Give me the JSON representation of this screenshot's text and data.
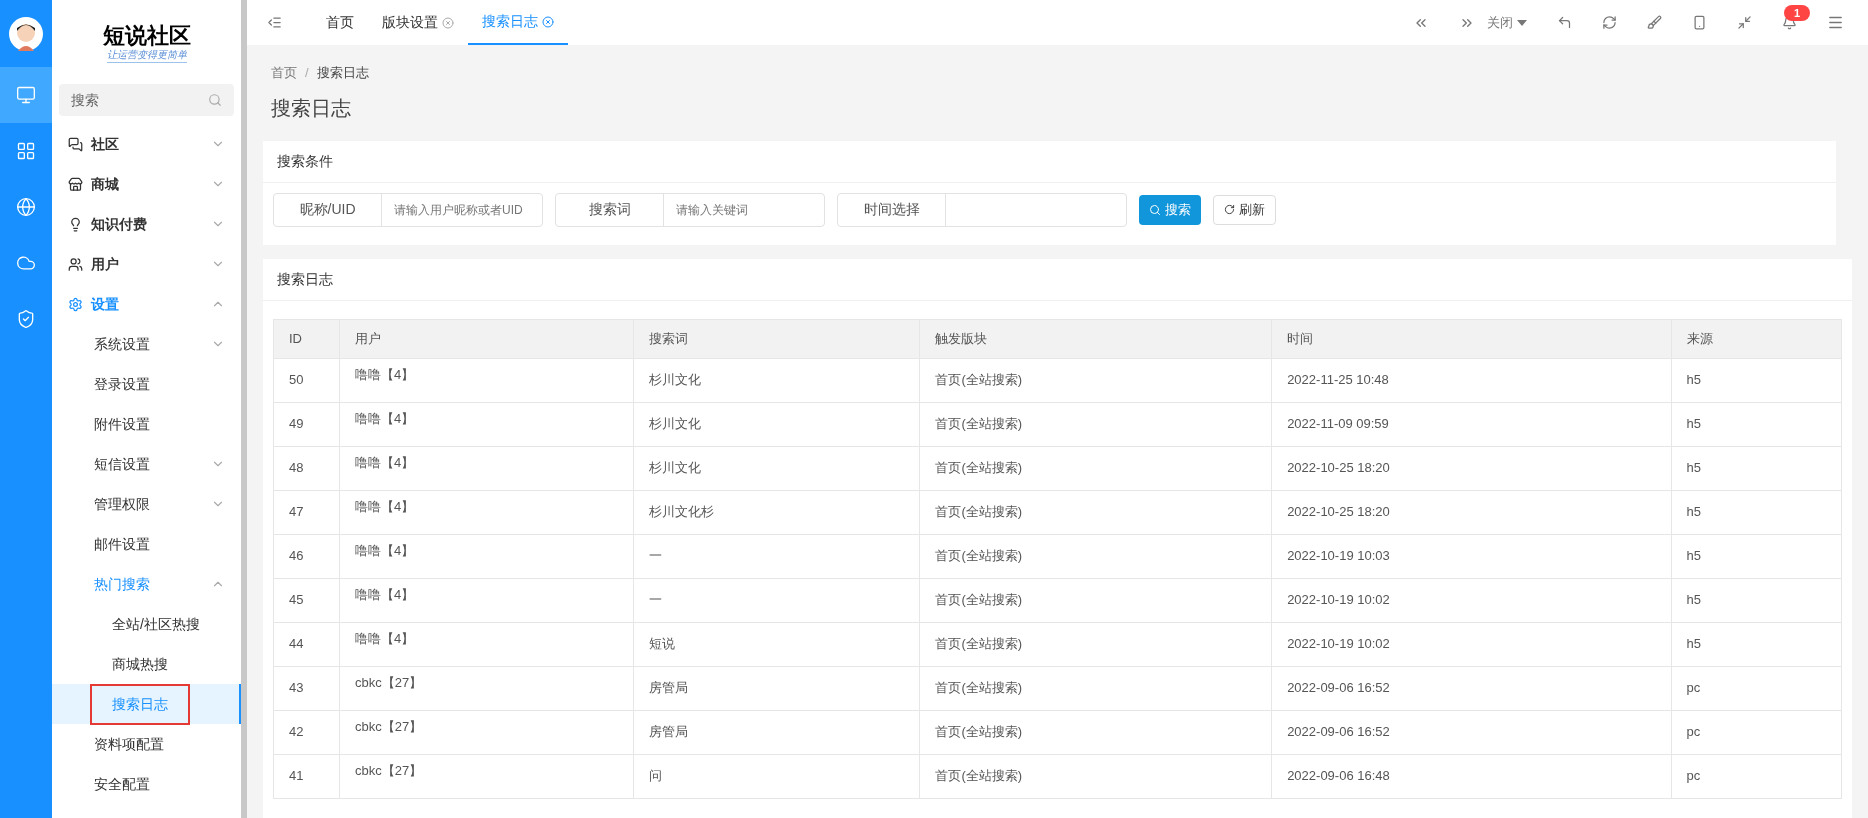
{
  "rail": [
    {
      "selected": true
    },
    {
      "selected": false
    },
    {
      "selected": false
    },
    {
      "selected": false
    },
    {
      "selected": false
    }
  ],
  "logo": {
    "title": "短说社区",
    "slogan": "让运营变得更简单"
  },
  "sidebar": {
    "search": {
      "placeholder": "搜索"
    },
    "items": [
      {
        "label": "社区",
        "kind": "group",
        "expanded": false,
        "selected": false
      },
      {
        "label": "商城",
        "kind": "group",
        "expanded": false,
        "selected": false
      },
      {
        "label": "知识付费",
        "kind": "group",
        "expanded": false,
        "selected": false
      },
      {
        "label": "用户",
        "kind": "group",
        "expanded": false,
        "selected": false
      },
      {
        "label": "设置",
        "kind": "group",
        "expanded": true,
        "selected": false,
        "children": [
          {
            "label": "系统设置",
            "kind": "group",
            "expanded": false,
            "selected": false
          },
          {
            "label": "登录设置",
            "kind": "link",
            "selected": false
          },
          {
            "label": "附件设置",
            "kind": "link",
            "selected": false
          },
          {
            "label": "短信设置",
            "kind": "group",
            "expanded": false,
            "selected": false
          },
          {
            "label": "管理权限",
            "kind": "group",
            "expanded": false,
            "selected": false
          },
          {
            "label": "邮件设置",
            "kind": "link",
            "selected": false
          },
          {
            "label": "热门搜索",
            "kind": "group",
            "expanded": true,
            "selected": false,
            "children": [
              {
                "label": "全站/社区热搜",
                "kind": "link",
                "selected": false
              },
              {
                "label": "商城热搜",
                "kind": "link",
                "selected": false
              },
              {
                "label": "搜索日志",
                "kind": "link",
                "selected": true
              }
            ]
          },
          {
            "label": "资料项配置",
            "kind": "link",
            "selected": false
          },
          {
            "label": "安全配置",
            "kind": "link",
            "selected": false
          }
        ]
      }
    ]
  },
  "tabs": [
    {
      "label": "首页",
      "closable": false,
      "selected": false
    },
    {
      "label": "版块设置",
      "closable": true,
      "selected": false
    },
    {
      "label": "搜索日志",
      "closable": true,
      "selected": true
    }
  ],
  "toolbar": {
    "close_menu": "关闭",
    "notification_count": "1"
  },
  "breadcrumb": [
    "首页",
    "搜索日志"
  ],
  "breadcrumb_separator": "/",
  "page_title": "搜索日志",
  "filter_card": {
    "title": "搜索条件",
    "fields": [
      {
        "label": "昵称/UID",
        "placeholder": "请输入用户昵称或者UID"
      },
      {
        "label": "搜索词",
        "placeholder": "请输入关键词"
      },
      {
        "label": "时间选择"
      }
    ],
    "search_button": "搜索",
    "refresh_button": "刷新"
  },
  "log_card": {
    "title": "搜索日志",
    "table": {
      "columns": [
        "ID",
        "用户",
        "搜索词",
        "触发版块",
        "时间",
        "来源"
      ],
      "rows": [
        [
          "50",
          "噜噜【4】",
          "杉川文化",
          "首页(全站搜索)",
          "2022-11-25 10:48",
          "h5"
        ],
        [
          "49",
          "噜噜【4】",
          "杉川文化",
          "首页(全站搜索)",
          "2022-11-09 09:59",
          "h5"
        ],
        [
          "48",
          "噜噜【4】",
          "杉川文化",
          "首页(全站搜索)",
          "2022-10-25 18:20",
          "h5"
        ],
        [
          "47",
          "噜噜【4】",
          "杉川文化杉",
          "首页(全站搜索)",
          "2022-10-25 18:20",
          "h5"
        ],
        [
          "46",
          "噜噜【4】",
          "一",
          "首页(全站搜索)",
          "2022-10-19 10:03",
          "h5"
        ],
        [
          "45",
          "噜噜【4】",
          "一",
          "首页(全站搜索)",
          "2022-10-19 10:02",
          "h5"
        ],
        [
          "44",
          "噜噜【4】",
          "短说",
          "首页(全站搜索)",
          "2022-10-19 10:02",
          "h5"
        ],
        [
          "43",
          "cbkc【27】",
          "房管局",
          "首页(全站搜索)",
          "2022-09-06 16:52",
          "pc"
        ],
        [
          "42",
          "cbkc【27】",
          "房管局",
          "首页(全站搜索)",
          "2022-09-06 16:52",
          "pc"
        ],
        [
          "41",
          "cbkc【27】",
          "问",
          "首页(全站搜索)",
          "2022-09-06 16:48",
          "pc"
        ]
      ]
    }
  }
}
